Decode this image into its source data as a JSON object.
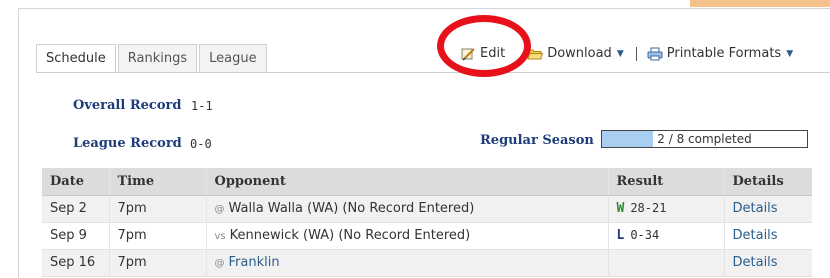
{
  "tabs": [
    {
      "label": "Schedule",
      "active": true
    },
    {
      "label": "Rankings",
      "active": false
    },
    {
      "label": "League",
      "active": false
    }
  ],
  "toolbar": {
    "edit_label": "Edit",
    "download_label": "Download",
    "printable_label": "Printable Formats"
  },
  "records": {
    "overall_label": "Overall Record",
    "overall_value": "1-1",
    "league_label": "League Record",
    "league_value": "0-0"
  },
  "season": {
    "label": "Regular Season",
    "progress_text": "2 / 8 completed",
    "completed": 2,
    "total": 8
  },
  "table": {
    "headers": [
      "Date",
      "Time",
      "Opponent",
      "Result",
      "Details"
    ],
    "rows": [
      {
        "date": "Sep 2",
        "time": "7pm",
        "prefix": "@",
        "opponent": "Walla Walla (WA) (No Record Entered)",
        "opponent_link": false,
        "result_letter": "W",
        "result_score": "28-21",
        "details": "Details"
      },
      {
        "date": "Sep 9",
        "time": "7pm",
        "prefix": "vs",
        "opponent": "Kennewick (WA) (No Record Entered)",
        "opponent_link": false,
        "result_letter": "L",
        "result_score": "0-34",
        "details": "Details"
      },
      {
        "date": "Sep 16",
        "time": "7pm",
        "prefix": "@",
        "opponent": "Franklin",
        "opponent_link": true,
        "result_letter": "",
        "result_score": "",
        "details": "Details"
      }
    ]
  },
  "colors": {
    "accent_link": "#2b5c8a",
    "label_blue": "#1d3c78",
    "win_green": "#2f8a2f",
    "annotation_red": "#e8101a",
    "progress_fill": "#a8cff2"
  },
  "icons": {
    "edit": "pencil-note-icon",
    "download": "folder-open-icon",
    "printable": "printer-icon"
  }
}
